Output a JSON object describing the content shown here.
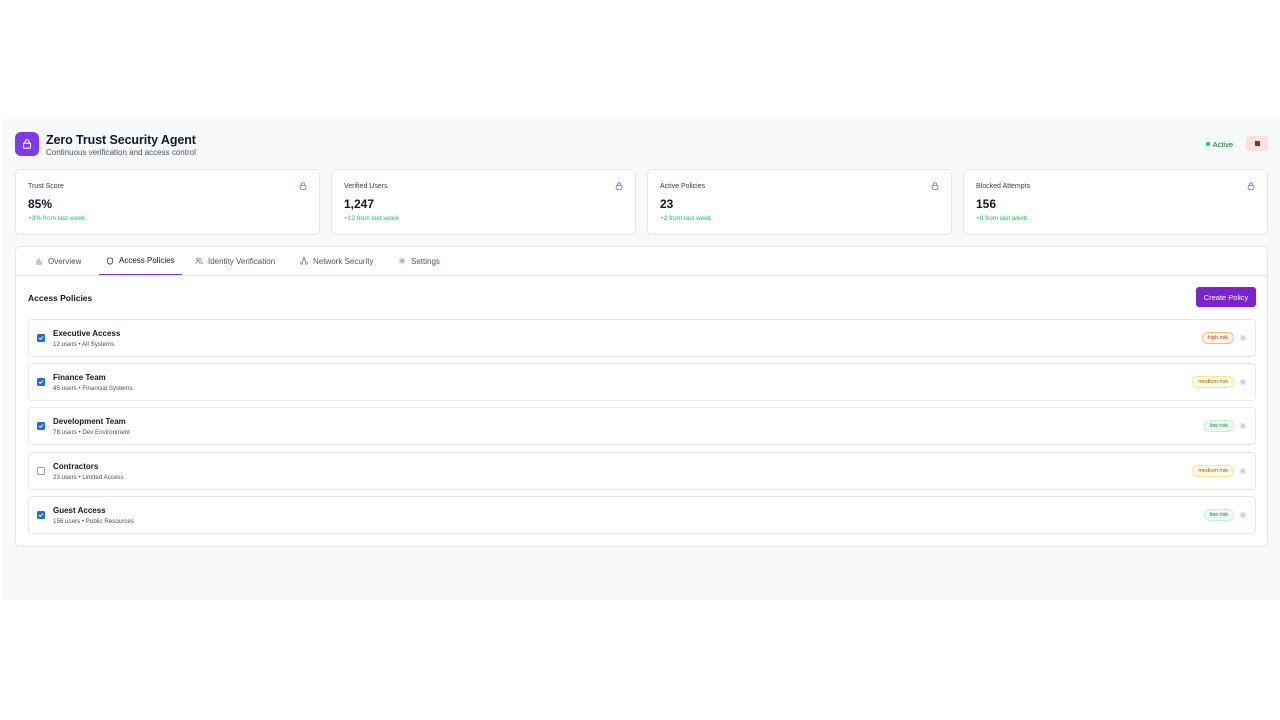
{
  "header": {
    "title": "Zero Trust Security Agent",
    "subtitle": "Continuous verification and access control",
    "status_label": "Active"
  },
  "stats": [
    {
      "label": "Trust Score",
      "value": "85%",
      "change": "+3% from last week"
    },
    {
      "label": "Verified Users",
      "value": "1,247",
      "change": "+12 from last week"
    },
    {
      "label": "Active Policies",
      "value": "23",
      "change": "+2 from last week"
    },
    {
      "label": "Blocked Attempts",
      "value": "156",
      "change": "+8 from last week"
    }
  ],
  "tabs": [
    {
      "label": "Overview",
      "icon": "bar-chart-icon"
    },
    {
      "label": "Access Policies",
      "icon": "shield-icon",
      "active": true
    },
    {
      "label": "Identity Verification",
      "icon": "users-icon"
    },
    {
      "label": "Network Security",
      "icon": "network-icon"
    },
    {
      "label": "Settings",
      "icon": "gear-icon"
    }
  ],
  "section": {
    "title": "Access Policies",
    "create_button": "Create Policy"
  },
  "policies": [
    {
      "name": "Executive Access",
      "meta": "12 users • All Systems",
      "risk": "high risk",
      "checked": true
    },
    {
      "name": "Finance Team",
      "meta": "45 users • Financial Systems",
      "risk": "medium risk",
      "checked": true
    },
    {
      "name": "Development Team",
      "meta": "78 users • Dev Environment",
      "risk": "low risk",
      "checked": true
    },
    {
      "name": "Contractors",
      "meta": "23 users • Limited Access",
      "risk": "medium risk",
      "checked": false
    },
    {
      "name": "Guest Access",
      "meta": "156 users • Public Resources",
      "risk": "low risk",
      "checked": true
    }
  ],
  "colors": {
    "accent": "#7c3aed",
    "primary_button": "#7e22ce",
    "positive": "#22c55e",
    "checkbox": "#1d6fd8"
  }
}
